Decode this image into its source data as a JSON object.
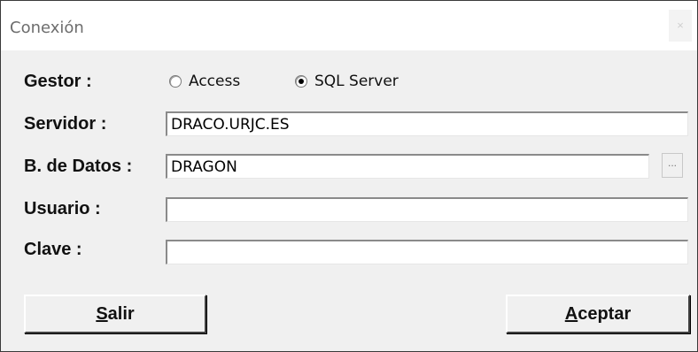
{
  "window": {
    "title": "Conexión",
    "close_glyph": "×"
  },
  "form": {
    "gestor_label": "Gestor :",
    "radio_options": [
      {
        "label": "Access",
        "selected": false
      },
      {
        "label": "SQL Server",
        "selected": true
      }
    ],
    "servidor_label": "Servidor :",
    "servidor_value": "DRACO.URJC.ES",
    "bdatos_label": "B. de Datos :",
    "bdatos_value": "DRAGON",
    "browse_label": "...",
    "usuario_label": "Usuario :",
    "usuario_value": "",
    "clave_label": "Clave :",
    "clave_value": ""
  },
  "buttons": {
    "salir_mnemonic": "S",
    "salir_rest": "alir",
    "aceptar_mnemonic": "A",
    "aceptar_rest": "ceptar"
  }
}
